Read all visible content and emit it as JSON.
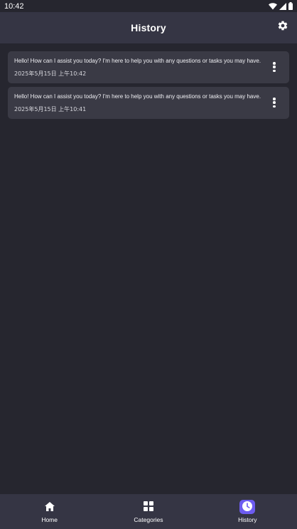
{
  "status_bar": {
    "time": "10:42",
    "icons": [
      "wifi-icon",
      "signal-icon",
      "battery-icon"
    ]
  },
  "app_bar": {
    "title": "History",
    "action_icon": "gear-icon"
  },
  "history": {
    "items": [
      {
        "message": "Hello! How can I assist you today? I'm here to help you with any questions or tasks you may have.",
        "time": "2025年5月15日 上午10:42"
      },
      {
        "message": "Hello! How can I assist you today? I'm here to help you with any questions or tasks you may have.",
        "time": "2025年5月15日 上午10:41"
      }
    ]
  },
  "bottom_nav": {
    "items": [
      {
        "label": "Home",
        "icon": "home-icon",
        "active": false
      },
      {
        "label": "Categories",
        "icon": "grid-icon",
        "active": false
      },
      {
        "label": "History",
        "icon": "clock-icon",
        "active": true
      }
    ]
  },
  "colors": {
    "background": "#26262f",
    "surface": "#353544",
    "card": "#3a3a45",
    "accent": "#6d5cf0",
    "text": "#ffffff"
  }
}
